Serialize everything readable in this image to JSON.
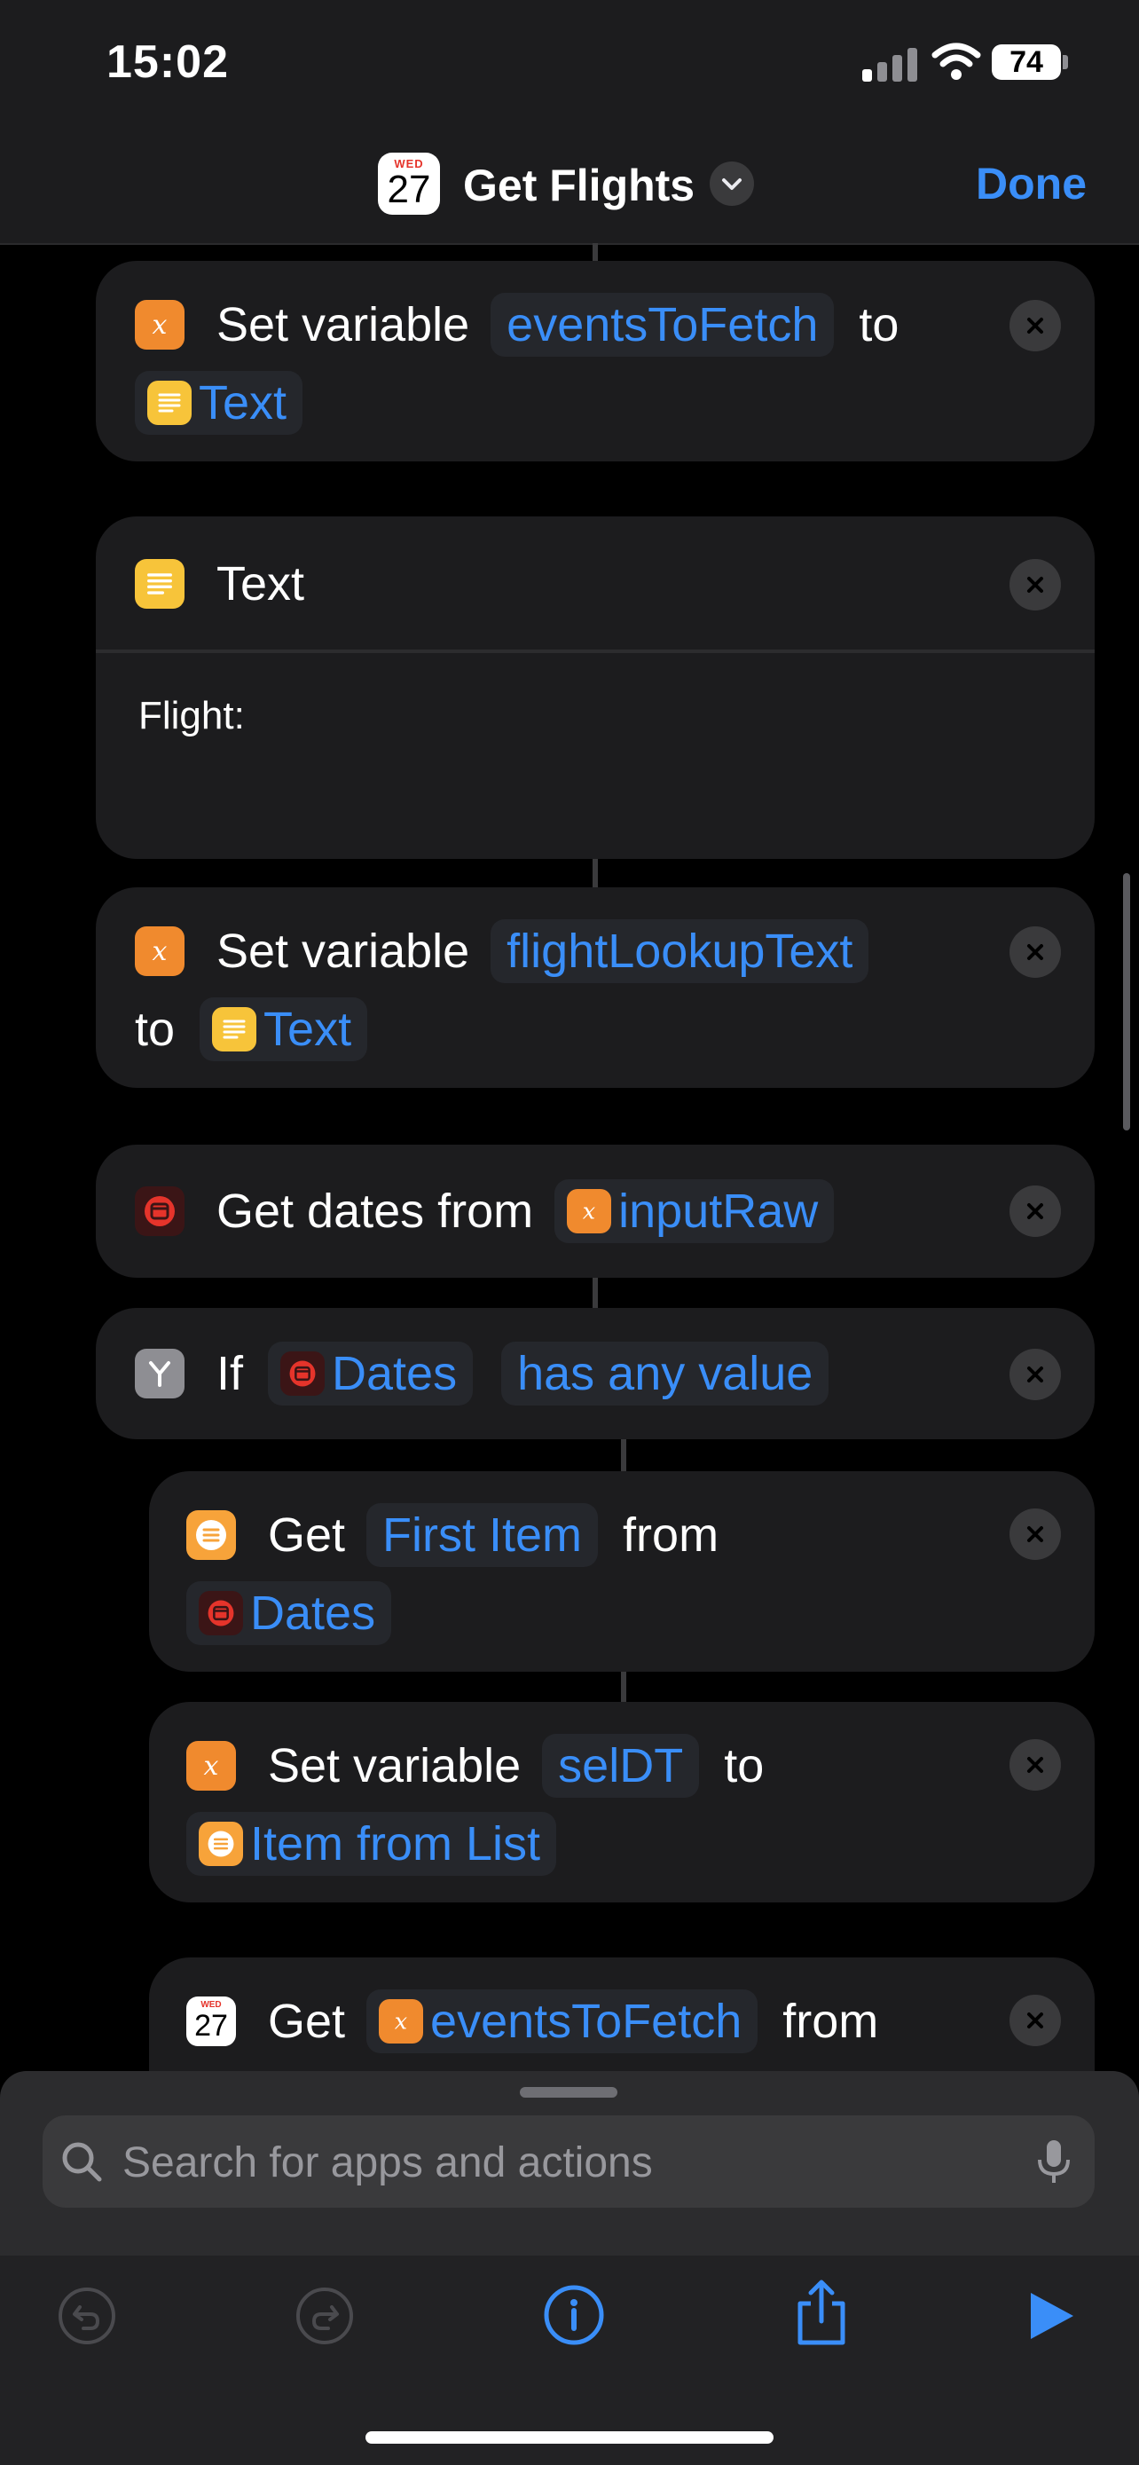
{
  "status_bar": {
    "time": "15:02",
    "battery": "74"
  },
  "nav": {
    "app_icon": {
      "weekday": "WED",
      "day": "27"
    },
    "title": "Get Flights",
    "done": "Done"
  },
  "actions": [
    {
      "kind": "set_variable",
      "label": "Set variable",
      "variable": "eventsToFetch",
      "to": "to",
      "value": "Text"
    },
    {
      "kind": "text",
      "label": "Text",
      "body": "Flight:"
    },
    {
      "kind": "set_variable",
      "label": "Set variable",
      "variable": "flightLookupText",
      "to": "to",
      "value": "Text"
    },
    {
      "kind": "get_dates",
      "label": "Get dates from",
      "value": "inputRaw"
    },
    {
      "kind": "if",
      "label": "If",
      "subject": "Dates",
      "condition": "has any value"
    },
    {
      "kind": "get_item",
      "label": "Get",
      "item": "First Item",
      "from": "from",
      "source": "Dates"
    },
    {
      "kind": "set_variable",
      "label": "Set variable",
      "variable": "selDT",
      "to": "to",
      "value": "Item from List"
    },
    {
      "kind": "get_events",
      "label": "Get",
      "variable": "eventsToFetch",
      "from": "from"
    }
  ],
  "search": {
    "placeholder": "Search for apps and actions"
  },
  "toolbar": [
    "undo-icon",
    "redo-icon",
    "info-icon",
    "share-icon",
    "run-icon"
  ],
  "colors": {
    "accent": "#3a8ef8",
    "card": "#1c1c1e",
    "pill": "#25272c",
    "variable": "#f08a2e",
    "text_action": "#f7c43a"
  }
}
